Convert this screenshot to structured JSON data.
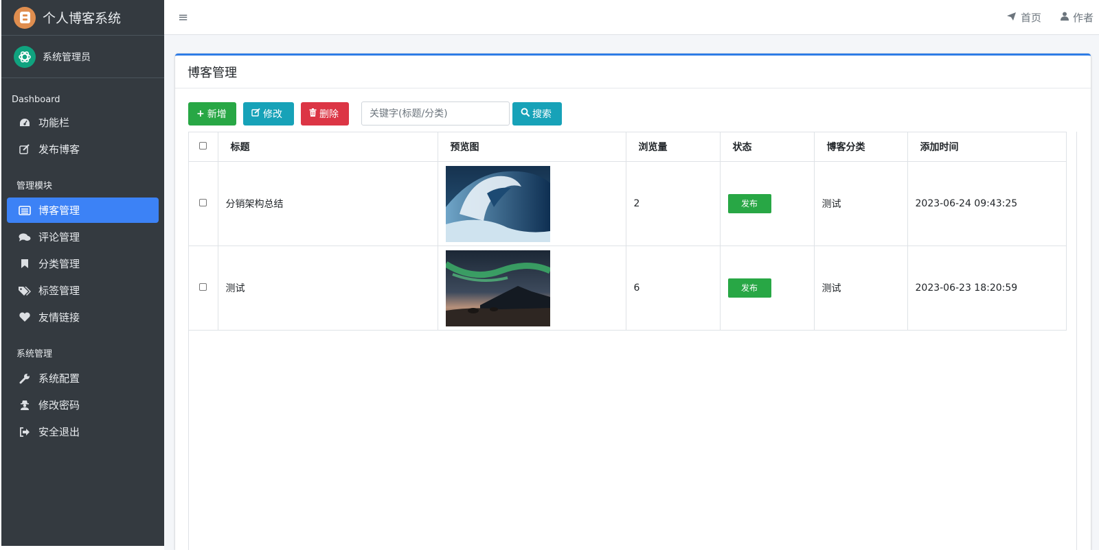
{
  "brand": {
    "title": "个人博客系统",
    "logo_icon": "blogger-logo-icon"
  },
  "user": {
    "name": "系统管理员",
    "avatar_icon": "openai-logo-icon"
  },
  "sidebar": {
    "sections": [
      {
        "header": "Dashboard",
        "items": [
          {
            "label": "功能栏",
            "icon": "tachometer-icon"
          },
          {
            "label": "发布博客",
            "icon": "edit-icon"
          }
        ]
      },
      {
        "header": "管理模块",
        "items": [
          {
            "label": "博客管理",
            "icon": "list-alt-icon",
            "active": true
          },
          {
            "label": "评论管理",
            "icon": "comments-icon"
          },
          {
            "label": "分类管理",
            "icon": "bookmark-icon"
          },
          {
            "label": "标签管理",
            "icon": "tags-icon"
          },
          {
            "label": "友情链接",
            "icon": "heart-icon"
          }
        ]
      },
      {
        "header": "系统管理",
        "items": [
          {
            "label": "系统配置",
            "icon": "wrench-icon"
          },
          {
            "label": "修改密码",
            "icon": "user-secret-icon"
          },
          {
            "label": "安全退出",
            "icon": "sign-out-icon"
          }
        ]
      }
    ]
  },
  "topbar": {
    "menu_icon": "hamburger-icon",
    "links": [
      {
        "label": "首页",
        "icon": "paper-plane-icon"
      },
      {
        "label": "作者",
        "icon": "user-icon"
      }
    ]
  },
  "card": {
    "title": "博客管理"
  },
  "toolbar": {
    "add_label": "新增",
    "edit_label": "修改",
    "delete_label": "删除",
    "search_placeholder": "关键字(标题/分类)",
    "search_label": "搜索"
  },
  "table": {
    "headers": {
      "title": "标题",
      "preview": "预览图",
      "views": "浏览量",
      "status": "状态",
      "category": "博客分类",
      "added": "添加时间"
    },
    "rows": [
      {
        "title": "分销架构总结",
        "preview": "ocean-wave-image",
        "views": "2",
        "status": "发布",
        "category": "测试",
        "added": "2023-06-24 09:43:25"
      },
      {
        "title": "测试",
        "preview": "aurora-mountain-image",
        "views": "6",
        "status": "发布",
        "category": "测试",
        "added": "2023-06-23 18:20:59"
      }
    ]
  },
  "colors": {
    "sidebar_bg": "#343a40",
    "active": "#3c82f6",
    "success": "#28a745",
    "info": "#17a2b8",
    "danger": "#dc3545"
  }
}
